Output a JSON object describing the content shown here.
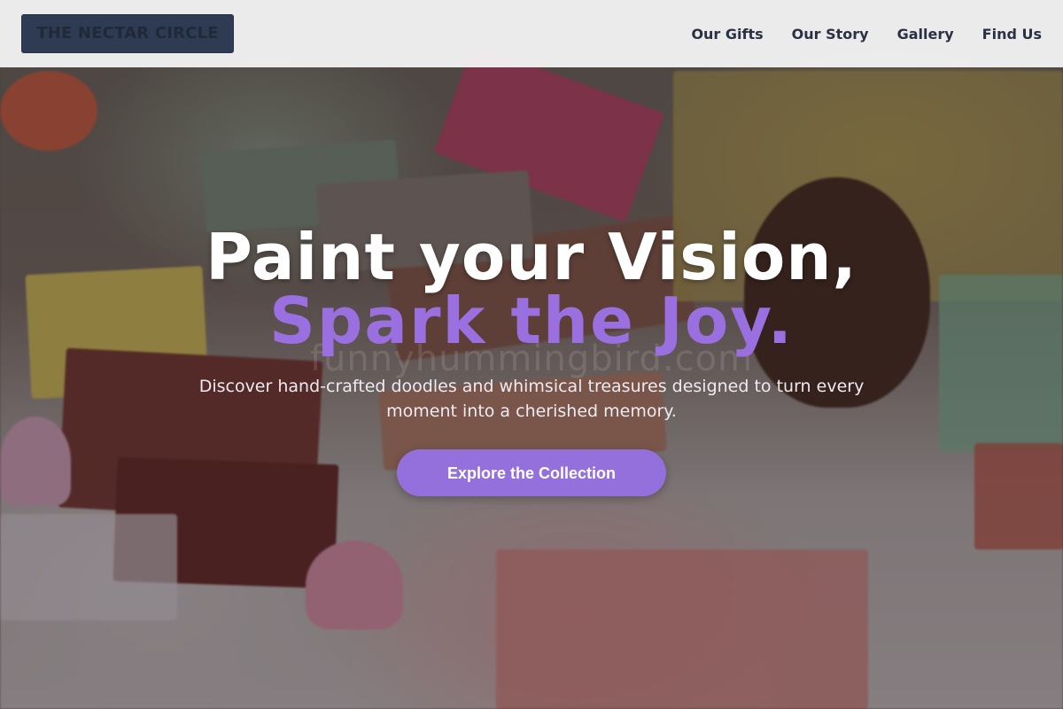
{
  "brand": {
    "name": "THE NECTAR CIRCLE"
  },
  "nav": {
    "items": [
      {
        "label": "Our Gifts"
      },
      {
        "label": "Our Story"
      },
      {
        "label": "Gallery"
      },
      {
        "label": "Find Us"
      }
    ]
  },
  "hero": {
    "headline_line1": "Paint your Vision,",
    "headline_line2": "Spark the Joy.",
    "watermark": "funnyhummingbird.com",
    "subtitle": "Discover hand-crafted doodles and whimsical treasures designed to turn every moment into a cherished memory.",
    "cta_label": "Explore the Collection"
  },
  "colors": {
    "accent": "#9470dc",
    "headline_accent": "#9a6fe0",
    "navbar_bg": "#f5f5f7",
    "logo_bg": "#2f3b52"
  }
}
